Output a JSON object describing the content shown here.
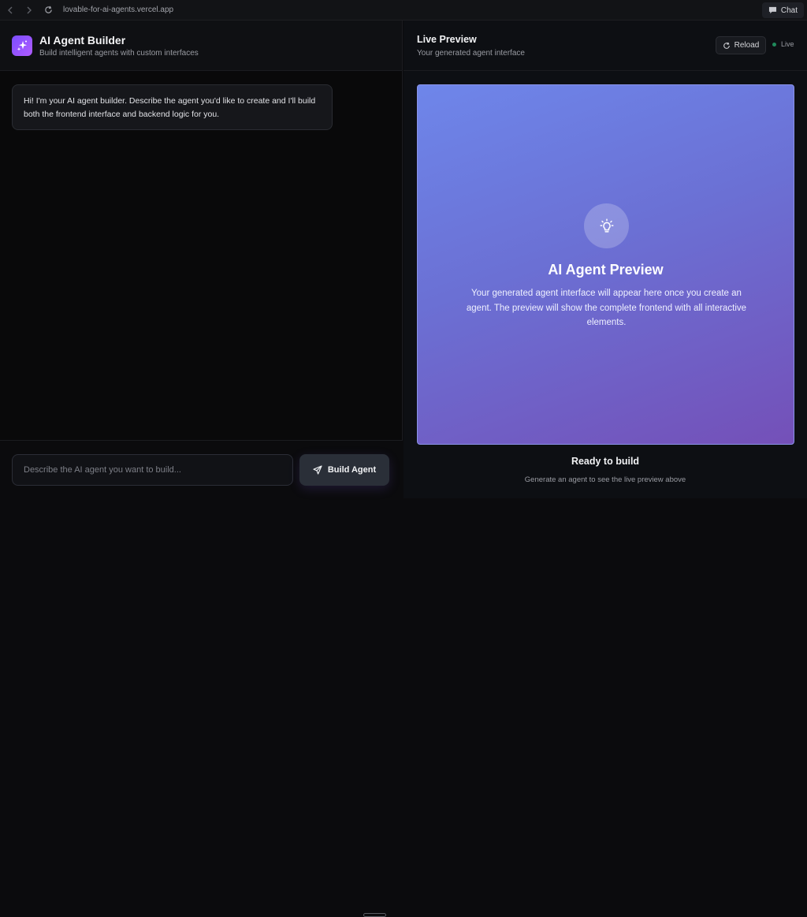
{
  "browser": {
    "url": "lovable-for-ai-agents.vercel.app",
    "chat_label": "Chat"
  },
  "builder": {
    "title": "AI Agent Builder",
    "subtitle": "Build intelligent agents with custom interfaces",
    "welcome_message": "Hi! I'm your AI agent builder. Describe the agent you'd like to create and I'll build both the frontend interface and backend logic for you.",
    "input_placeholder": "Describe the AI agent you want to build...",
    "build_button": "Build Agent"
  },
  "preview": {
    "title": "Live Preview",
    "subtitle": "Your generated agent interface",
    "reload_label": "Reload",
    "live_label": "Live",
    "card_title": "AI Agent Preview",
    "card_description": "Your generated agent interface will appear here once you create an agent. The preview will show the complete frontend with all interactive elements.",
    "status_title": "Ready to build",
    "status_subtitle": "Generate an agent to see the live preview above"
  },
  "colors": {
    "accent": "#7b4dff",
    "live_dot": "#1f8a5b",
    "gradient_start": "#6e86ea",
    "gradient_end": "#7450b8"
  },
  "icons": [
    "back-icon",
    "forward-icon",
    "refresh-icon",
    "chat-icon",
    "sparkles-icon",
    "send-icon",
    "reload-icon",
    "lightbulb-icon"
  ]
}
